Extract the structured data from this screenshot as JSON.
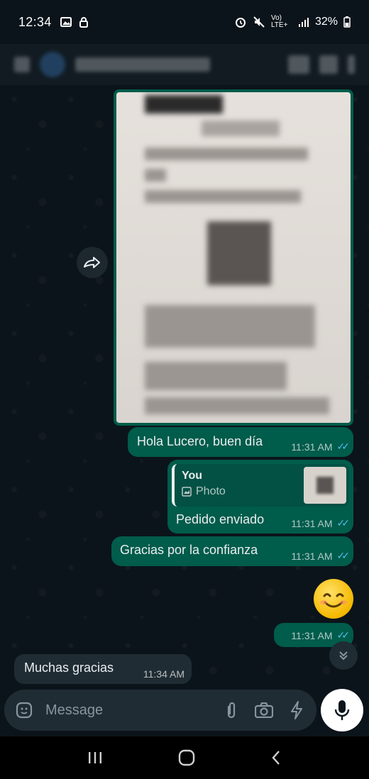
{
  "status_bar": {
    "time": "12:34",
    "network": "Vo) LTE+",
    "battery": "32%"
  },
  "header": {
    "title_obscured": true
  },
  "messages": [
    {
      "type": "photo",
      "direction": "out"
    },
    {
      "type": "text",
      "direction": "out",
      "text": "Hola Lucero, buen día",
      "time": "11:31 AM"
    },
    {
      "type": "reply",
      "direction": "out",
      "reply_author": "You",
      "reply_kind": "Photo",
      "text": "Pedido enviado",
      "time": "11:31 AM"
    },
    {
      "type": "text",
      "direction": "out",
      "text": "Gracias por la confianza",
      "time": "11:31 AM"
    },
    {
      "type": "emoji",
      "direction": "out",
      "emoji": "smiling-face-icon"
    },
    {
      "type": "time_only",
      "direction": "out",
      "time": "11:31 AM"
    },
    {
      "type": "text",
      "direction": "in",
      "text": "Muchas gracias",
      "time": "11:34 AM"
    }
  ],
  "input": {
    "placeholder": "Message"
  },
  "colors": {
    "outgoing_bubble": "#005c4b",
    "incoming_bubble": "#202c33",
    "read_ticks": "#53bdeb",
    "background": "#0b141a"
  }
}
